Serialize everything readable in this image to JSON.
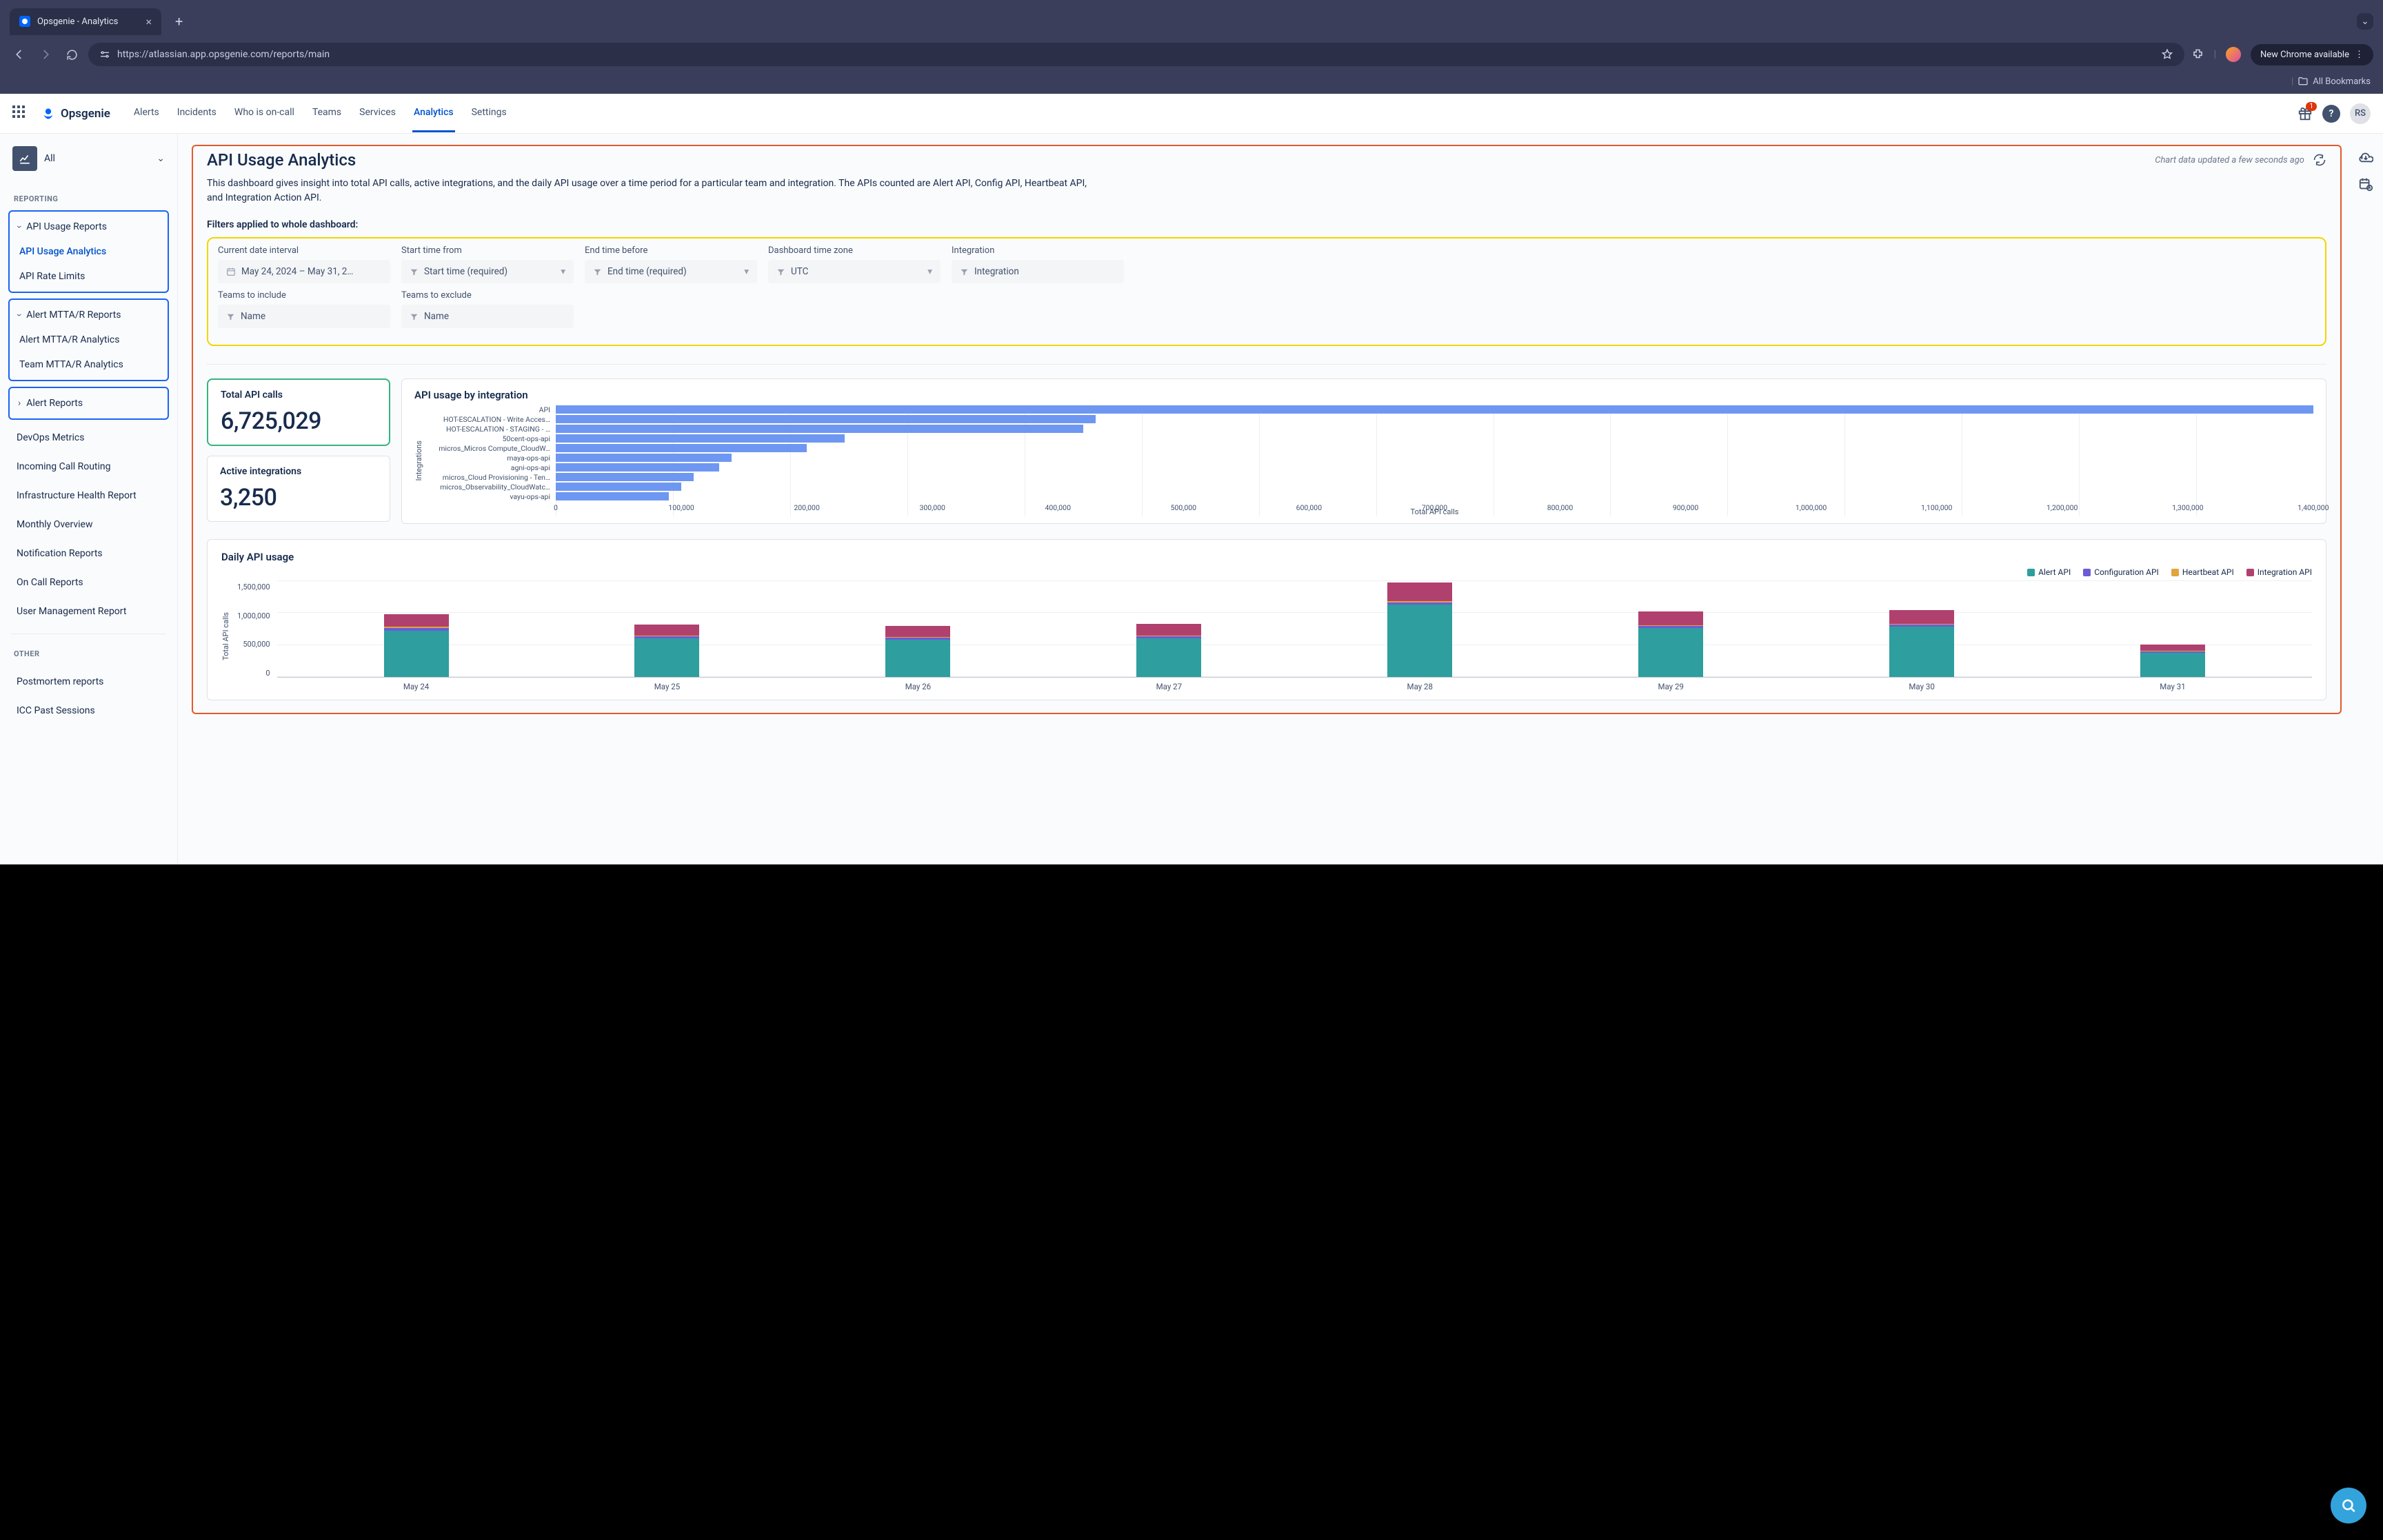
{
  "browser": {
    "tab_title": "Opsgenie - Analytics",
    "url": "https://atlassian.app.opsgenie.com/reports/main",
    "new_chrome": "New Chrome available",
    "all_bookmarks": "All Bookmarks"
  },
  "header": {
    "brand": "Opsgenie",
    "nav": [
      "Alerts",
      "Incidents",
      "Who is on-call",
      "Teams",
      "Services",
      "Analytics",
      "Settings"
    ],
    "active_nav_index": 5,
    "badge_count": "1",
    "user_initials": "RS"
  },
  "sidebar": {
    "top_label": "All",
    "section_reporting": "REPORTING",
    "groups": [
      {
        "parent": "API Usage Reports",
        "children": [
          "API Usage Analytics",
          "API Rate Limits"
        ],
        "active_child_index": 0
      },
      {
        "parent": "Alert MTTA/R Reports",
        "children": [
          "Alert MTTA/R Analytics",
          "Team MTTA/R Analytics"
        ]
      },
      {
        "parent": "Alert Reports",
        "collapsed": true
      }
    ],
    "items": [
      "DevOps Metrics",
      "Incoming Call Routing",
      "Infrastructure Health Report",
      "Monthly Overview",
      "Notification Reports",
      "On Call Reports",
      "User Management Report"
    ],
    "section_other": "OTHER",
    "other_items": [
      "Postmortem reports",
      "ICC Past Sessions"
    ]
  },
  "page": {
    "title": "API Usage Analytics",
    "updated_text": "Chart data updated a few seconds ago",
    "description": "This dashboard gives insight into total API calls, active integrations, and the daily API usage over a time period for a particular team and integration. The APIs counted are Alert API, Config API, Heartbeat API, and Integration Action API.",
    "filters_label": "Filters applied to whole dashboard:"
  },
  "filters": {
    "row1": [
      {
        "label": "Current date interval",
        "icon": "calendar",
        "value": "May 24, 2024  –  May 31, 2…"
      },
      {
        "label": "Start time from",
        "icon": "funnel",
        "value": "Start time (required)",
        "caret": true
      },
      {
        "label": "End time before",
        "icon": "funnel",
        "value": "End time (required)",
        "caret": true
      },
      {
        "label": "Dashboard time zone",
        "icon": "funnel",
        "value": "UTC",
        "caret": true
      },
      {
        "label": "Integration",
        "icon": "funnel",
        "value": "Integration"
      }
    ],
    "row2": [
      {
        "label": "Teams to include",
        "icon": "funnel",
        "value": "Name"
      },
      {
        "label": "Teams to exclude",
        "icon": "funnel",
        "value": "Name"
      }
    ]
  },
  "metrics": {
    "total_calls": {
      "title": "Total API calls",
      "value": "6,725,029"
    },
    "active_integrations": {
      "title": "Active integrations",
      "value": "3,250"
    }
  },
  "hbar": {
    "title": "API usage by integration",
    "ylabel": "Integrations",
    "xtitle": "Total API calls"
  },
  "daily": {
    "title": "Daily API usage",
    "ylabel": "Total API calls",
    "legend": [
      "Alert API",
      "Configuration API",
      "Heartbeat API",
      "Integration API"
    ]
  },
  "chart_data": {
    "hbar": {
      "type": "bar",
      "orientation": "horizontal",
      "xlabel": "Total API calls",
      "ylabel": "Integrations",
      "xlim": [
        0,
        1400000
      ],
      "xticks": [
        0,
        100000,
        200000,
        300000,
        400000,
        500000,
        600000,
        700000,
        800000,
        900000,
        1000000,
        1100000,
        1200000,
        1300000,
        1400000
      ],
      "categories": [
        "API",
        "HOT-ESCALATION - Write Acces…",
        "HOT-ESCALATION - STAGING - …",
        "50cent-ops-api",
        "micros_Micros Compute_CloudW…",
        "maya-ops-api",
        "agni-ops-api",
        "micros_Cloud Provisioning - Ten…",
        "micros_Observability_CloudWatc…",
        "vayu-ops-api"
      ],
      "values": [
        1400000,
        430000,
        420000,
        230000,
        200000,
        140000,
        130000,
        110000,
        100000,
        90000
      ]
    },
    "daily": {
      "type": "stacked-bar",
      "ylabel": "Total API calls",
      "ylim": [
        0,
        1500000
      ],
      "yticks": [
        0,
        500000,
        1000000,
        1500000
      ],
      "categories": [
        "May 24",
        "May 25",
        "May 26",
        "May 27",
        "May 28",
        "May 29",
        "May 30",
        "May 31"
      ],
      "series": [
        {
          "name": "Alert API",
          "color": "#2e9e9e",
          "values": [
            720000,
            600000,
            580000,
            600000,
            1120000,
            760000,
            780000,
            380000
          ]
        },
        {
          "name": "Configuration API",
          "color": "#6b5cd6",
          "values": [
            40000,
            30000,
            30000,
            30000,
            40000,
            30000,
            30000,
            15000
          ]
        },
        {
          "name": "Heartbeat API",
          "color": "#e2a43b",
          "values": [
            20000,
            15000,
            15000,
            15000,
            20000,
            15000,
            15000,
            10000
          ]
        },
        {
          "name": "Integration API",
          "color": "#b0416e",
          "values": [
            200000,
            170000,
            170000,
            180000,
            290000,
            210000,
            210000,
            100000
          ]
        }
      ]
    }
  }
}
